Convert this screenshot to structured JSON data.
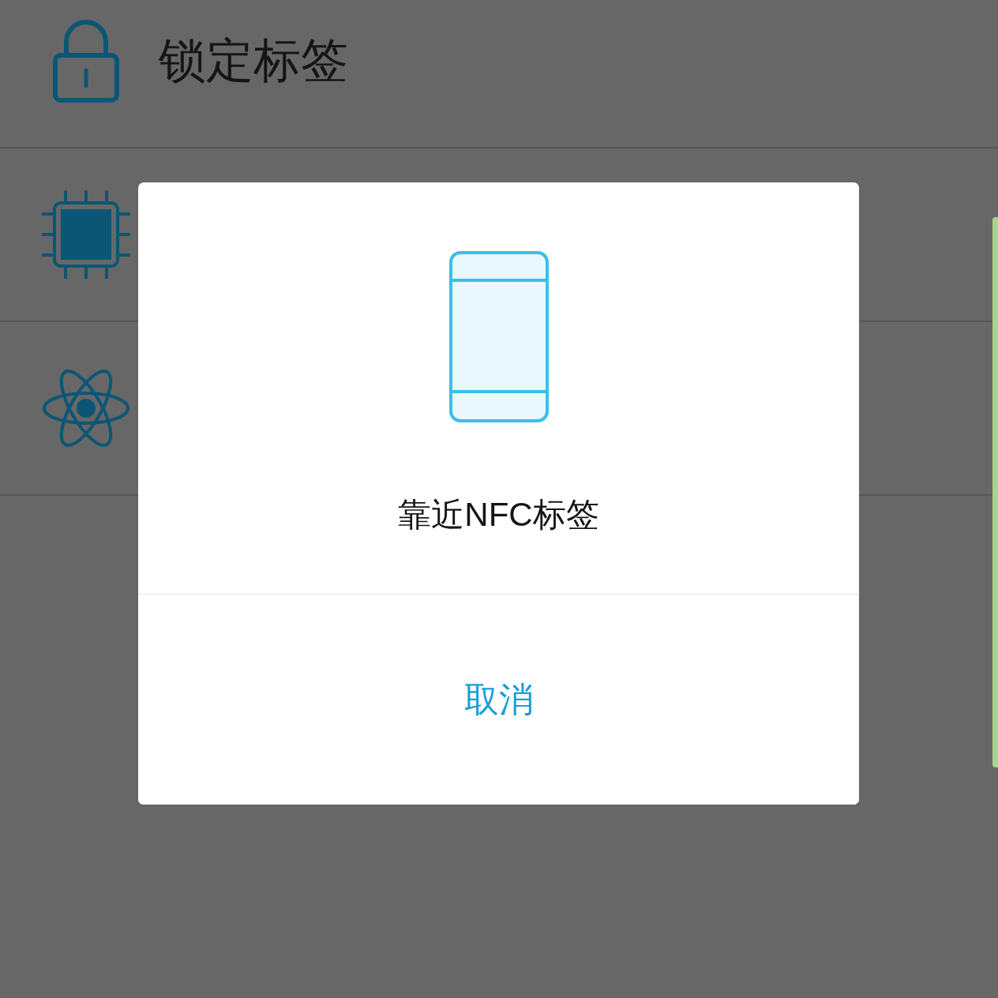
{
  "list": {
    "items": [
      {
        "kind": "lock",
        "label": "锁定标签"
      },
      {
        "kind": "chip"
      },
      {
        "kind": "atom"
      }
    ]
  },
  "dialog": {
    "message": "靠近NFC标签",
    "buttons": [
      {
        "label": "取消"
      }
    ]
  }
}
